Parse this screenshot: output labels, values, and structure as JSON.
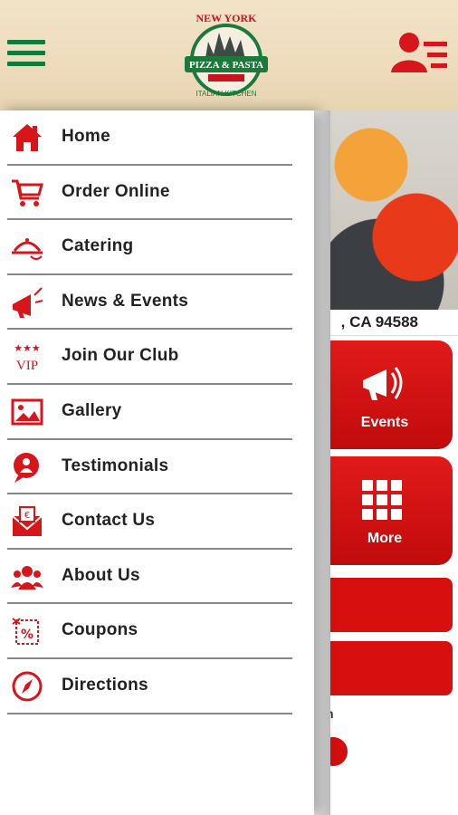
{
  "header": {
    "menu_icon": "hamburger-icon",
    "logo_top": "NEW YORK",
    "logo_main": "PIZZA & PASTA",
    "logo_bottom": "ITALIAN KITCHEN",
    "user_icon": "user-menu-icon"
  },
  "background": {
    "address_fragment": ", CA 94588",
    "tile_events": "Events",
    "tile_more": "More",
    "text_fragment": "n"
  },
  "drawer": {
    "items": [
      {
        "label": "Home",
        "icon": "home-icon"
      },
      {
        "label": "Order Online",
        "icon": "cart-icon"
      },
      {
        "label": "Catering",
        "icon": "catering-icon"
      },
      {
        "label": "News & Events",
        "icon": "megaphone-icon"
      },
      {
        "label": "Join Our Club",
        "icon": "vip-icon"
      },
      {
        "label": "Gallery",
        "icon": "gallery-icon"
      },
      {
        "label": "Testimonials",
        "icon": "testimonials-icon"
      },
      {
        "label": "Contact Us",
        "icon": "envelope-icon"
      },
      {
        "label": "About Us",
        "icon": "people-icon"
      },
      {
        "label": "Coupons",
        "icon": "coupon-icon"
      },
      {
        "label": "Directions",
        "icon": "compass-icon"
      }
    ]
  },
  "colors": {
    "accent_red": "#d80f0f",
    "brand_green": "#137a3c"
  }
}
